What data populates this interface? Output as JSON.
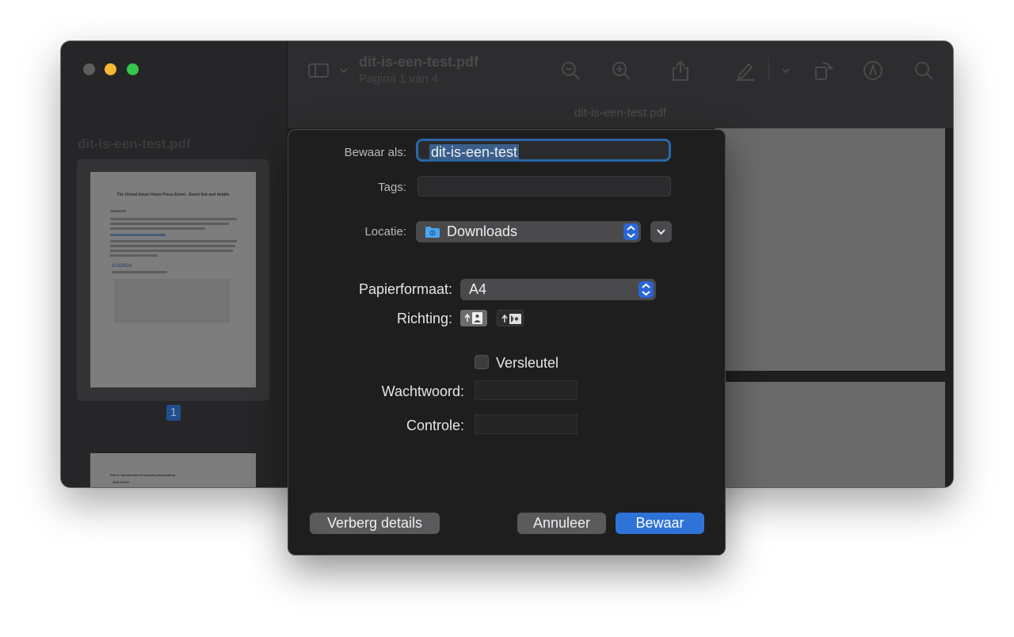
{
  "sidebar": {
    "title": "dit-is-een-test.pdf",
    "page_number": "1",
    "thumb": {
      "title": "The Virtual Smart Home Press Event - Event link and details",
      "agenda": "AGENDA",
      "part": "Part 1: Introduction & keynote presentation",
      "host": "OUR HOST:"
    }
  },
  "toolbar": {
    "title": "dit-is-een-test.pdf",
    "subtitle": "Pagina 1 van 4",
    "filename": "dit-is-een-test.pdf",
    "icons": [
      "sidebar-icon",
      "chevron-down-icon",
      "zoom-out-icon",
      "zoom-in-icon",
      "share-icon",
      "markup-pen-icon",
      "chevron-down-icon",
      "rotate-icon",
      "annotate-icon",
      "search-icon"
    ]
  },
  "dialog": {
    "save_as_label": "Bewaar als:",
    "save_as_value": "dit-is-een-test",
    "tags_label": "Tags:",
    "location_label": "Locatie:",
    "location_value": "Downloads",
    "paper_label": "Papierformaat:",
    "paper_value": "A4",
    "orientation_label": "Richting:",
    "encrypt_label": "Versleutel",
    "encrypt_checked": false,
    "password_label": "Wachtwoord:",
    "verify_label": "Controle:",
    "hide_details_button": "Verberg details",
    "cancel_button": "Annuleer",
    "save_button": "Bewaar",
    "accent_color": "#2f73d9"
  }
}
